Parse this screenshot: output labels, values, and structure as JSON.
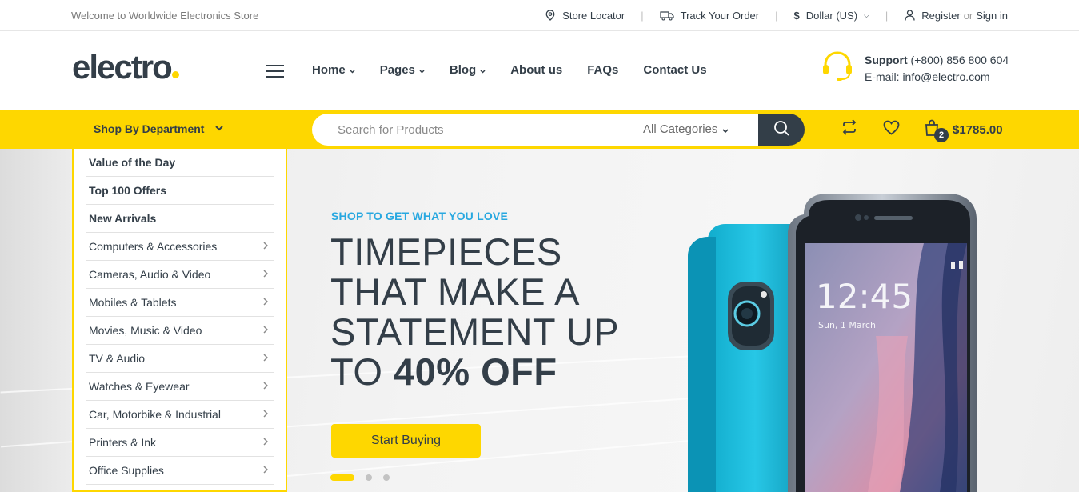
{
  "topbar": {
    "welcome": "Welcome to Worldwide Electronics Store",
    "store_locator": "Store Locator",
    "track_order": "Track Your Order",
    "currency": "Dollar (US)",
    "register": "Register",
    "or": "or",
    "sign_in": "Sign in"
  },
  "header": {
    "logo": "electro",
    "nav": [
      {
        "label": "Home",
        "has_caret": true
      },
      {
        "label": "Pages",
        "has_caret": true
      },
      {
        "label": "Blog",
        "has_caret": true
      },
      {
        "label": "About us",
        "has_caret": false
      },
      {
        "label": "FAQs",
        "has_caret": false
      },
      {
        "label": "Contact Us",
        "has_caret": false
      }
    ],
    "support_label": "Support",
    "support_phone": "(+800) 856 800 604",
    "support_email": "E-mail: info@electro.com"
  },
  "bar": {
    "shop_by_department": "Shop By Department",
    "search_placeholder": "Search for Products",
    "category_select": "All Categories",
    "cart_count": "2",
    "cart_total": "$1785.00"
  },
  "sidebar": {
    "items": [
      {
        "label": "Value of the Day",
        "bold": true,
        "arrow": false
      },
      {
        "label": "Top 100 Offers",
        "bold": true,
        "arrow": false
      },
      {
        "label": "New Arrivals",
        "bold": true,
        "arrow": false
      },
      {
        "label": "Computers & Accessories",
        "bold": false,
        "arrow": true
      },
      {
        "label": "Cameras, Audio & Video",
        "bold": false,
        "arrow": true
      },
      {
        "label": "Mobiles & Tablets",
        "bold": false,
        "arrow": true
      },
      {
        "label": "Movies, Music & Video",
        "bold": false,
        "arrow": true
      },
      {
        "label": "TV & Audio",
        "bold": false,
        "arrow": true
      },
      {
        "label": "Watches & Eyewear",
        "bold": false,
        "arrow": true
      },
      {
        "label": "Car, Motorbike & Industrial",
        "bold": false,
        "arrow": true
      },
      {
        "label": "Printers & Ink",
        "bold": false,
        "arrow": true
      },
      {
        "label": "Office Supplies",
        "bold": false,
        "arrow": true
      }
    ]
  },
  "hero": {
    "kicker": "SHOP TO GET WHAT YOU LOVE",
    "line1": "TIMEPIECES",
    "line2": "THAT MAKE A",
    "line3": "STATEMENT UP",
    "line4_prefix": "TO ",
    "line4_bold": "40% OFF",
    "cta": "Start Buying",
    "slide_count": 3,
    "active_slide": 1,
    "phone_time": "12:45",
    "phone_date": "Sun, 1 March"
  },
  "colors": {
    "accent": "#fed700",
    "dark": "#333e48",
    "kicker": "#28a8e0"
  }
}
